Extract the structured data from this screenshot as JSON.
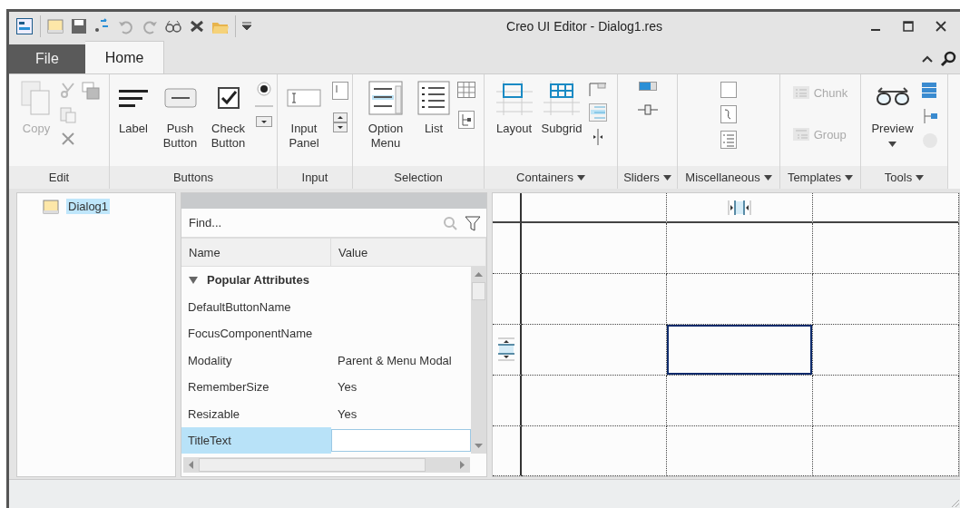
{
  "window": {
    "title": "Creo UI Editor - Dialog1.res"
  },
  "menu_tabs": [
    {
      "label": "File",
      "kind": "file",
      "selected": false
    },
    {
      "label": "Home",
      "kind": "tab",
      "selected": true
    }
  ],
  "ribbon_groups": [
    {
      "label": "Edit",
      "menu": false,
      "buttons": [
        {
          "label": "Copy",
          "kind": "large",
          "disabled": true
        }
      ]
    },
    {
      "label": "Buttons",
      "menu": false,
      "buttons": [
        {
          "label": "Label",
          "kind": "large",
          "disabled": false
        },
        {
          "label": "Push Button",
          "kind": "large",
          "disabled": false
        },
        {
          "label": "Check Button",
          "kind": "large",
          "disabled": false
        }
      ]
    },
    {
      "label": "Input",
      "menu": false,
      "buttons": [
        {
          "label": "Input Panel",
          "kind": "large",
          "disabled": false
        }
      ]
    },
    {
      "label": "Selection",
      "menu": false,
      "buttons": [
        {
          "label": "Option Menu",
          "kind": "large",
          "disabled": false
        },
        {
          "label": "List",
          "kind": "large",
          "disabled": false
        }
      ]
    },
    {
      "label": "Containers",
      "menu": true,
      "buttons": [
        {
          "label": "Layout",
          "kind": "large",
          "disabled": false
        },
        {
          "label": "Subgrid",
          "kind": "large",
          "disabled": false
        }
      ]
    },
    {
      "label": "Sliders",
      "menu": true
    },
    {
      "label": "Miscellaneous",
      "menu": true
    },
    {
      "label": "Templates",
      "menu": true,
      "buttons": [
        {
          "label": "Chunk",
          "kind": "small",
          "disabled": true
        },
        {
          "label": "Group",
          "kind": "small",
          "disabled": true
        }
      ]
    },
    {
      "label": "Tools",
      "menu": true,
      "buttons": [
        {
          "label": "Preview",
          "kind": "large",
          "disabled": false
        }
      ]
    }
  ],
  "tree": [
    {
      "label": "Dialog1",
      "selected": true
    }
  ],
  "properties": {
    "search": {
      "placeholder": "Find..."
    },
    "columns": [
      "Name",
      "Value"
    ],
    "section": {
      "label": "Popular Attributes",
      "expanded": true
    },
    "rows": [
      {
        "name": "DefaultButtonName",
        "selected": false
      },
      {
        "name": "FocusComponentName",
        "selected": false
      },
      {
        "name": "Modality",
        "value": "Parent & Menu Modal",
        "selected": false
      },
      {
        "name": "RememberSize",
        "value": "Yes",
        "selected": false
      },
      {
        "name": "Resizable",
        "value": "Yes",
        "selected": false
      },
      {
        "name": "TitleText",
        "selected": true
      }
    ]
  },
  "layout_grid": {
    "rows": [
      {
        "cells": [
          {
            "selected": false
          },
          {
            "selected": false
          },
          {
            "selected": false
          }
        ]
      },
      {
        "cells": [
          {
            "selected": false
          },
          {
            "selected": false
          },
          {
            "selected": false
          }
        ]
      },
      {
        "cells": [
          {
            "selected": false
          },
          {
            "selected": true
          },
          {
            "selected": false
          }
        ]
      },
      {
        "cells": [
          {
            "selected": false
          },
          {
            "selected": false
          },
          {
            "selected": false
          }
        ]
      },
      {
        "cells": [
          {
            "selected": false
          },
          {
            "selected": false
          },
          {
            "selected": false
          }
        ]
      }
    ]
  }
}
